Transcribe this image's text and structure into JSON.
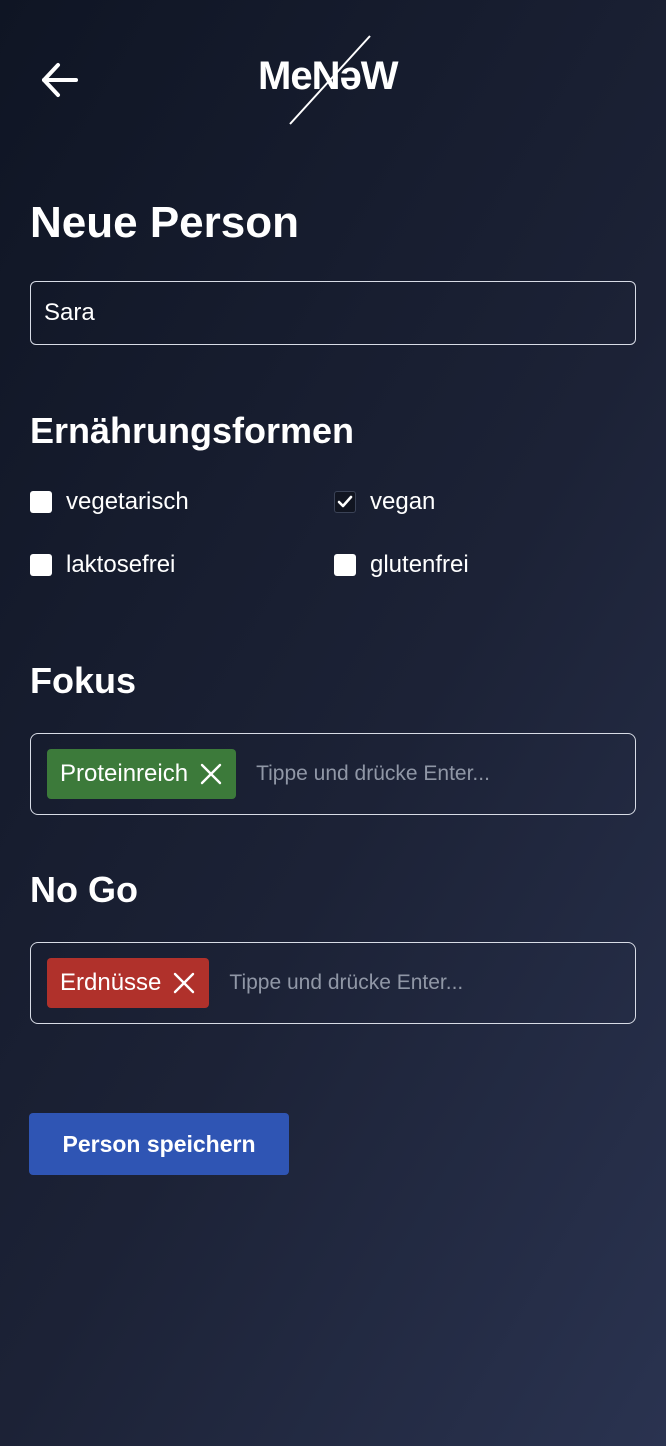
{
  "header": {
    "logo_text": "MeNəW",
    "back_icon": "arrow-left-icon"
  },
  "page": {
    "title": "Neue Person"
  },
  "name_field": {
    "value": "Sara"
  },
  "diets": {
    "title": "Ernährungsformen",
    "options": [
      {
        "label": "vegetarisch",
        "checked": false
      },
      {
        "label": "vegan",
        "checked": true
      },
      {
        "label": "laktosefrei",
        "checked": false
      },
      {
        "label": "glutenfrei",
        "checked": false
      }
    ]
  },
  "focus": {
    "title": "Fokus",
    "tags": [
      {
        "label": "Proteinreich",
        "color": "#3c7a3a"
      }
    ],
    "placeholder": "Tippe und drücke Enter..."
  },
  "nogo": {
    "title": "No Go",
    "tags": [
      {
        "label": "Erdnüsse",
        "color": "#b0312b"
      }
    ],
    "placeholder": "Tippe und drücke Enter..."
  },
  "actions": {
    "save_label": "Person speichern",
    "save_color": "#2f55b4"
  }
}
